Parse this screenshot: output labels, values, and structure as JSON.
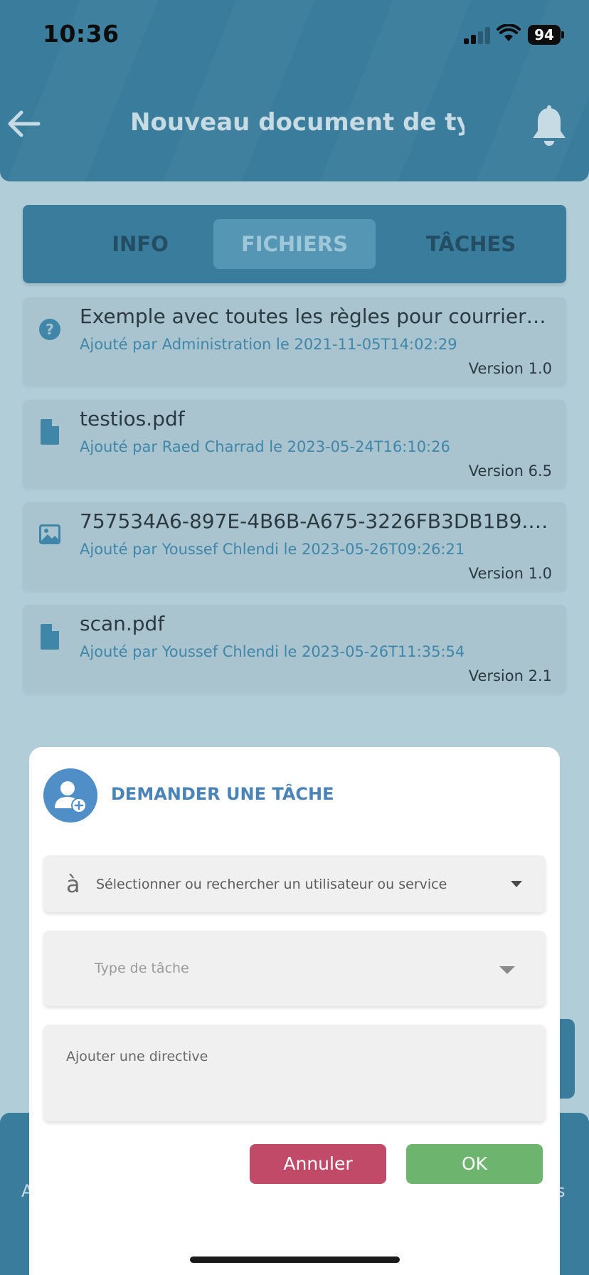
{
  "status_bar": {
    "time": "10:36",
    "battery": "94"
  },
  "header": {
    "title": "Nouveau document de ty…"
  },
  "tabs": [
    "INFO",
    "FICHIERS",
    "TÂCHES"
  ],
  "active_tab": "FICHIERS",
  "files": [
    {
      "name": "Exemple avec toutes les règles pour courrier …",
      "meta": "Ajouté par Administration le 2021-11-05T14:02:29",
      "version": "Version 1.0",
      "icon": "help-circle-icon"
    },
    {
      "name": "testios.pdf",
      "meta": "Ajouté par Raed Charrad le 2023-05-24T16:10:26",
      "version": "Version 6.5",
      "icon": "file-icon"
    },
    {
      "name": "757534A6-897E-4B6B-A675-3226FB3DB1B9.p…",
      "meta": "Ajouté par Youssef Chlendi le 2023-05-26T09:26:21",
      "version": "Version 1.0",
      "icon": "image-icon"
    },
    {
      "name": "scan.pdf",
      "meta": "Ajouté par Youssef Chlendi le 2023-05-26T11:35:54",
      "version": "Version 2.1",
      "icon": "file-icon"
    }
  ],
  "bottom_bar": {
    "left_fragment": "A",
    "right_fragment": "s"
  },
  "modal": {
    "title": "DEMANDER UNE TÂCHE",
    "recipient_prefix": "à",
    "recipient_placeholder": "Sélectionner ou rechercher un utilisateur ou service",
    "task_type_placeholder": "Type de tâche",
    "directive_placeholder": "Ajouter une directive",
    "cancel_label": "Annuler",
    "ok_label": "OK"
  },
  "colors": {
    "primary": "#3a7c9c",
    "cancel": "#c14a69",
    "ok": "#6db46f",
    "accent": "#4a83b8"
  }
}
